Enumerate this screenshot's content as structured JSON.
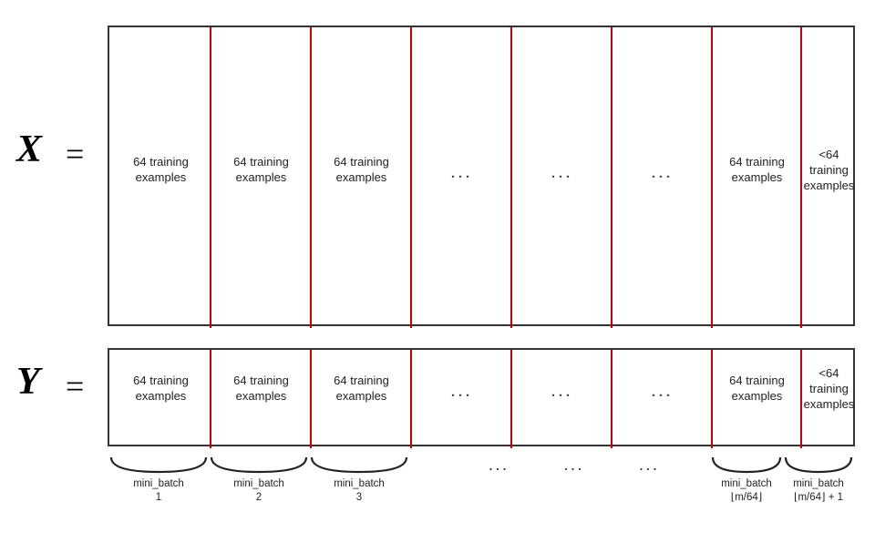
{
  "labels": {
    "x": "X",
    "y": "Y",
    "equals": "="
  },
  "cells": {
    "full_batch": "64 training examples",
    "partial_batch": "<64 training examples"
  },
  "dots": "...",
  "mini_batches": [
    {
      "label": "mini_batch",
      "sub": "1"
    },
    {
      "label": "mini_batch",
      "sub": "2"
    },
    {
      "label": "mini_batch",
      "sub": "3"
    },
    {
      "label": "...",
      "sub": ""
    },
    {
      "label": "...",
      "sub": ""
    },
    {
      "label": "...",
      "sub": ""
    },
    {
      "label": "mini_batch",
      "sub": "⌊m/64⌋"
    },
    {
      "label": "mini_batch",
      "sub": "⌊m/64⌋ + 1"
    }
  ],
  "colors": {
    "red_divider": "#cc0000",
    "border": "#333333",
    "background": "#ffffff"
  }
}
